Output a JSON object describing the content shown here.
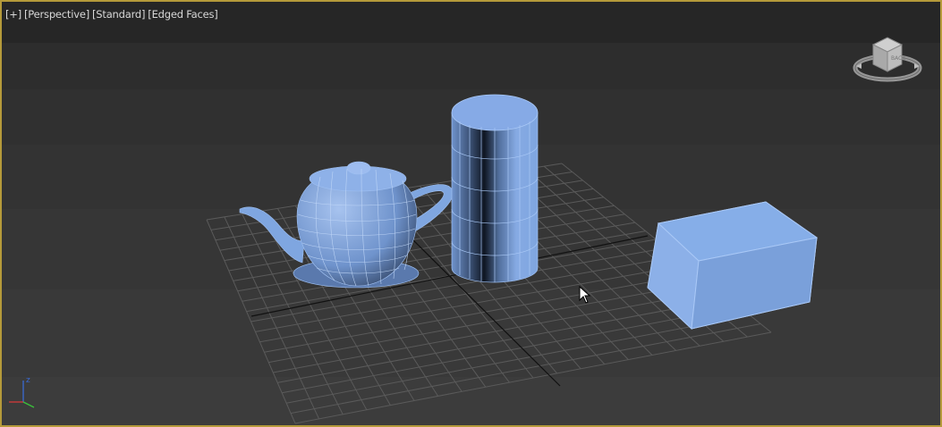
{
  "viewport": {
    "labels": {
      "menu": "[+]",
      "view": "[Perspective]",
      "shading": "[Standard]",
      "mode": "[Edged Faces]"
    }
  },
  "viewcube": {
    "face_label": "BACK"
  },
  "axis_tripod": {
    "z_label": "z",
    "x_color": "#d43a3a",
    "y_color": "#3ac23a",
    "z_color": "#3a6ad4"
  },
  "scene": {
    "objects": [
      {
        "name": "teapot",
        "color": "#7fa6e0"
      },
      {
        "name": "cylinder",
        "color": "#7fa6e0"
      },
      {
        "name": "box",
        "color": "#7fa6e0"
      }
    ],
    "grid_color": "#5a5a5a",
    "axis_line_color": "#111111"
  },
  "colors": {
    "viewport_border": "#b59a3a",
    "label_text": "#d8d8d8"
  }
}
